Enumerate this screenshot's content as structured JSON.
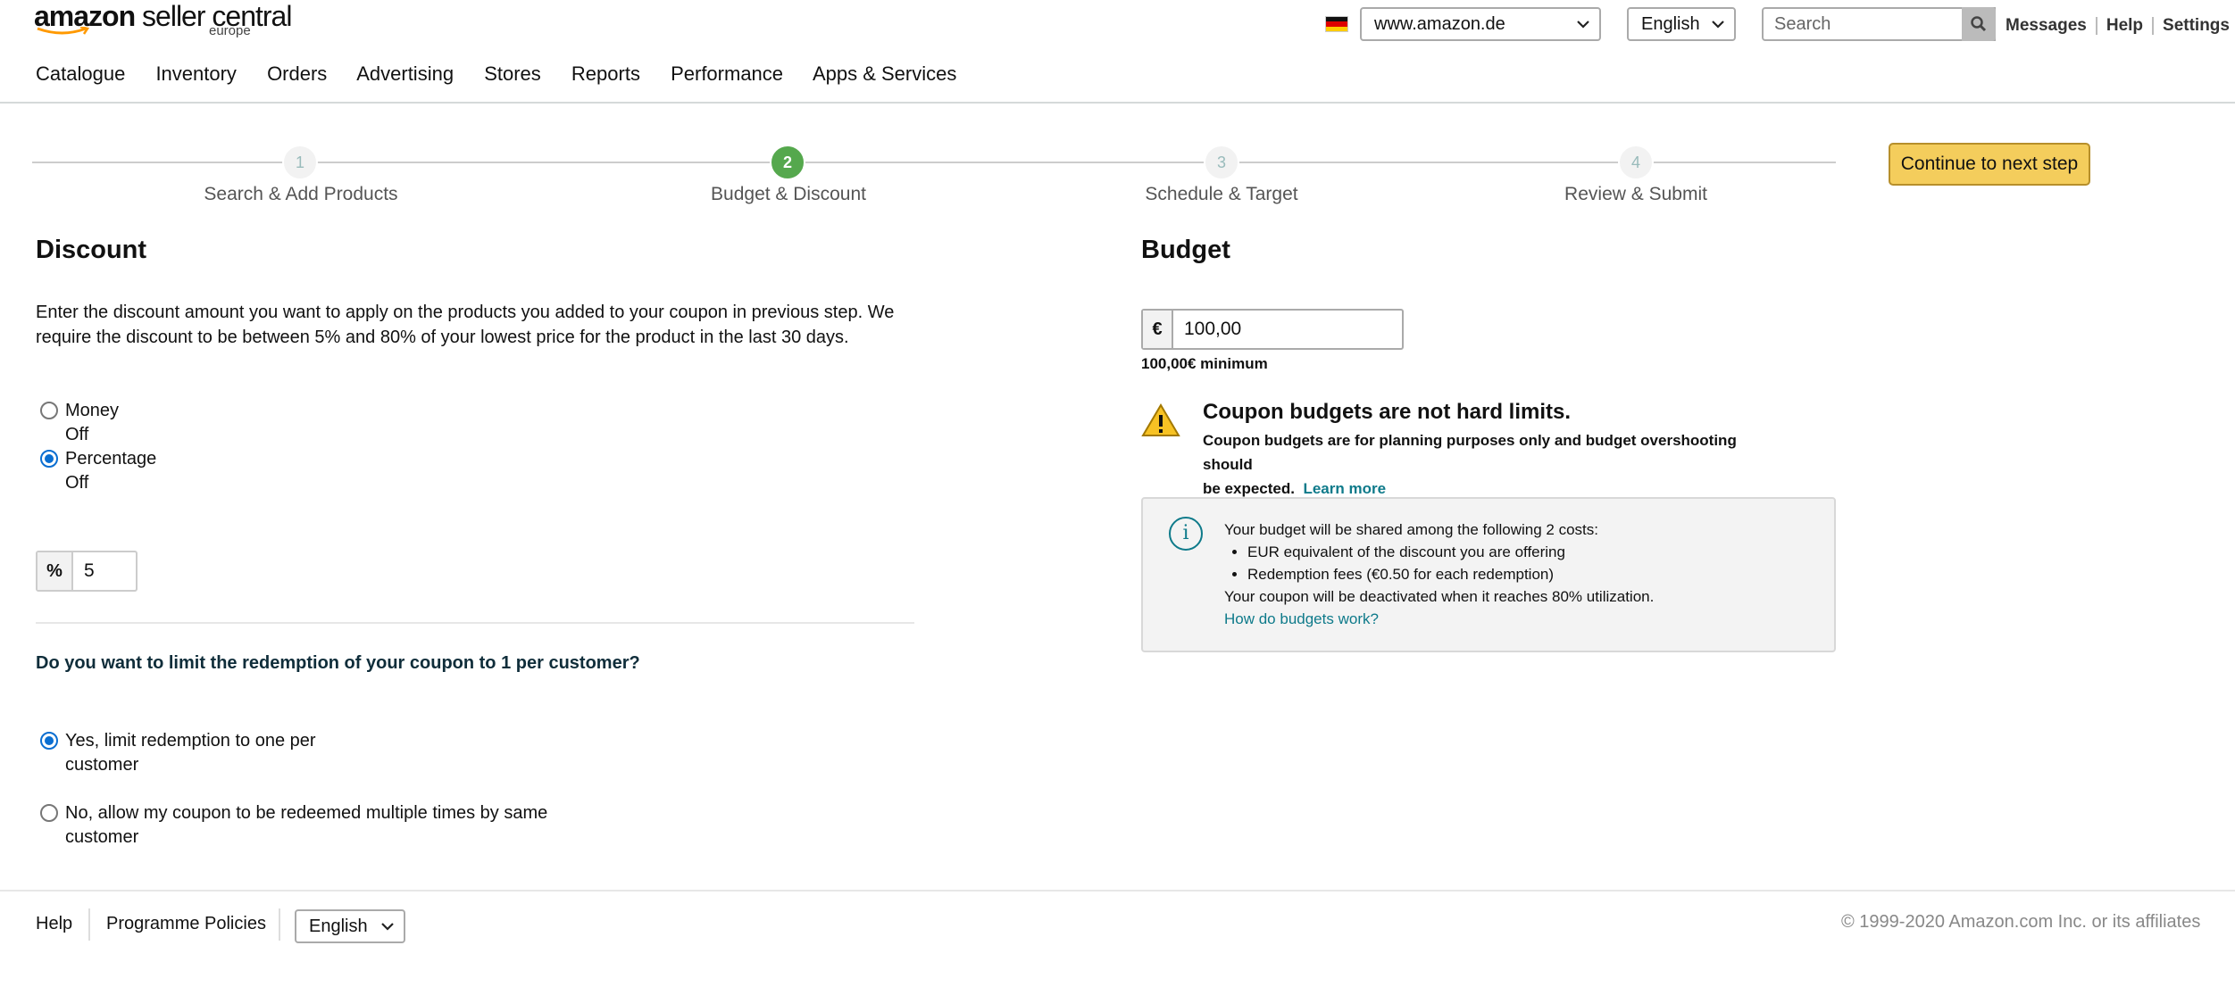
{
  "header": {
    "logo_brand": "amazon",
    "logo_product": "seller central",
    "logo_region": "europe",
    "marketplace": "www.amazon.de",
    "language": "English",
    "search_placeholder": "Search",
    "links": [
      "Messages",
      "Help",
      "Settings"
    ]
  },
  "nav": [
    "Catalogue",
    "Inventory",
    "Orders",
    "Advertising",
    "Stores",
    "Reports",
    "Performance",
    "Apps & Services"
  ],
  "steps": [
    {
      "num": "1",
      "label": "Search & Add Products"
    },
    {
      "num": "2",
      "label": "Budget & Discount"
    },
    {
      "num": "3",
      "label": "Schedule & Target"
    },
    {
      "num": "4",
      "label": "Review & Submit"
    }
  ],
  "continue_label": "Continue to next step",
  "discount": {
    "title": "Discount",
    "description": "Enter the discount amount you want to apply on the products you added to your coupon in previous step. We require the discount to be between 5% and 80% of your lowest price for the product in the last 30 days.",
    "options": [
      {
        "line1": "Money",
        "line2": "Off"
      },
      {
        "line1": "Percentage",
        "line2": "Off"
      }
    ],
    "selected": "Percentage",
    "percent_symbol": "%",
    "percent_value": "5",
    "limit_question": "Do you want to limit the redemption of your coupon to 1 per customer?",
    "limit_yes_1": "Yes, limit redemption to one per",
    "limit_yes_2": "customer",
    "limit_no_1": "No, allow my coupon to be redeemed multiple times by same",
    "limit_no_2": "customer"
  },
  "budget": {
    "title": "Budget",
    "currency_symbol": "€",
    "value": "100,00",
    "minimum": "100,00€ minimum",
    "warning_title": "Coupon budgets are not hard limits.",
    "warning_text_1": "Coupon budgets are for planning purposes only and budget overshooting should",
    "warning_text_2": "be expected.",
    "learn_more": "Learn more",
    "info_intro": "Your budget will be shared among the following 2 costs:",
    "info_items": [
      "EUR equivalent of the discount you are offering",
      "Redemption fees (€0.50 for each redemption)"
    ],
    "info_outro": "Your coupon will be deactivated when it reaches 80% utilization.",
    "info_link": "How do budgets work?"
  },
  "footer": {
    "help": "Help",
    "policies": "Programme Policies",
    "language": "English",
    "copyright": "© 1999-2020 Amazon.com Inc. or its affiliates"
  }
}
